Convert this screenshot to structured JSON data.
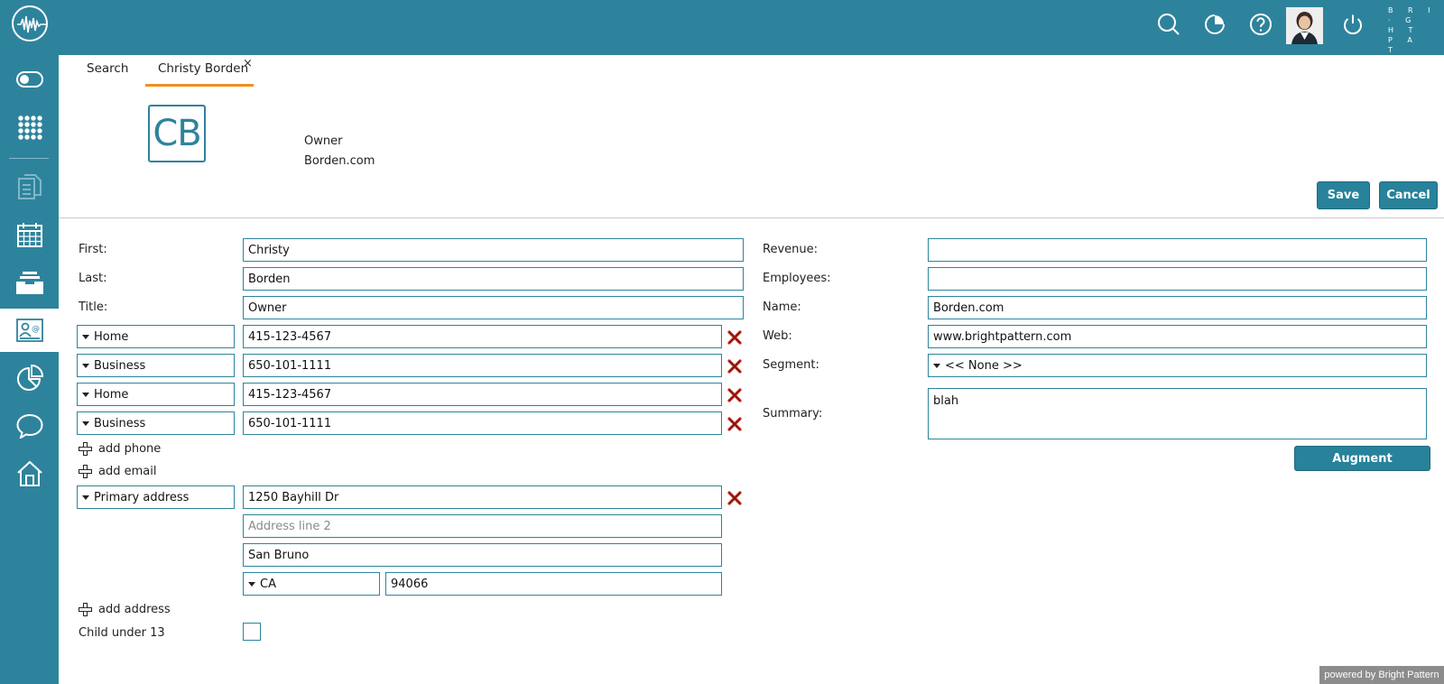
{
  "brand": {
    "lines": [
      "B R I",
      "· G H T",
      "P A T",
      "T E R",
      "N"
    ]
  },
  "tabs": [
    {
      "label": "Search"
    },
    {
      "label": "Christy Borden"
    }
  ],
  "tab_close_glyph": "×",
  "header": {
    "initials": "CB",
    "title": "Owner",
    "company": "Borden.com"
  },
  "buttons": {
    "save": "Save",
    "cancel": "Cancel",
    "augment": "Augment"
  },
  "form": {
    "first": {
      "label": "First:",
      "value": "Christy"
    },
    "last": {
      "label": "Last:",
      "value": "Borden"
    },
    "title": {
      "label": "Title:",
      "value": "Owner"
    },
    "phones": [
      {
        "type": "Home",
        "value": "415-123-4567"
      },
      {
        "type": "Business",
        "value": "650-101-1111"
      },
      {
        "type": "Home",
        "value": "415-123-4567"
      },
      {
        "type": "Business",
        "value": "650-101-1111"
      }
    ],
    "add_phone": "add phone",
    "add_email": "add email",
    "address": {
      "type": "Primary address",
      "line1": "1250 Bayhill Dr",
      "line2_placeholder": "Address line 2",
      "city": "San Bruno",
      "state": "CA",
      "zip": "94066"
    },
    "add_address": "add address",
    "child_label": "Child under 13",
    "revenue": {
      "label": "Revenue:",
      "value": ""
    },
    "employees": {
      "label": "Employees:",
      "value": ""
    },
    "name": {
      "label": "Name:",
      "value": "Borden.com"
    },
    "web": {
      "label": "Web:",
      "value": "www.brightpattern.com"
    },
    "segment": {
      "label": "Segment:",
      "value": "<< None >>"
    },
    "summary": {
      "label": "Summary:",
      "value": "blah"
    }
  },
  "footer": "powered by Bright Pattern",
  "colors": {
    "primary": "#2e839c",
    "tab_accent": "#f0901e",
    "delete": "#c0281c"
  }
}
